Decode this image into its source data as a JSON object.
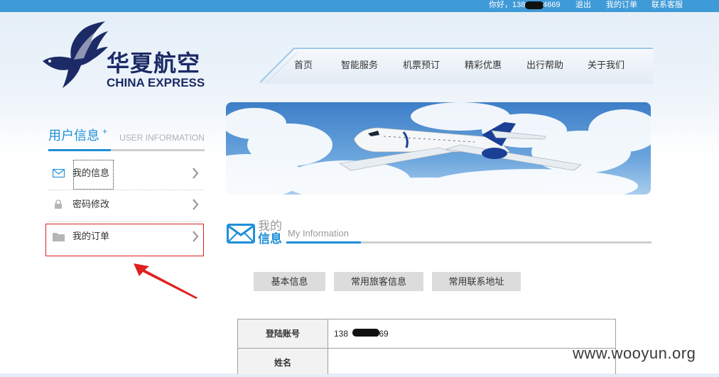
{
  "topbar": {
    "greeting": "你好，138",
    "phone_tail": "4669",
    "logout": "退出",
    "my_orders": "我的订单",
    "contact": "联系客服"
  },
  "logo": {
    "cn": "华夏航空",
    "en": "CHINA EXPRESS",
    "icon": "bird-icon"
  },
  "nav": {
    "items": [
      "首页",
      "智能服务",
      "机票预订",
      "精彩优惠",
      "出行帮助",
      "关于我们"
    ]
  },
  "banner": {
    "icon": "airplane-banner"
  },
  "sidebar": {
    "title": "用户信息",
    "plus": "+",
    "subtitle": "USER INFORMATION",
    "items": [
      {
        "label": "我的信息",
        "icon": "envelope-icon"
      },
      {
        "label": "密码修改",
        "icon": "lock-icon"
      },
      {
        "label": "我的订单",
        "icon": "folder-icon"
      }
    ]
  },
  "info": {
    "title_line1": "我的",
    "title_line2": "信息",
    "title_en": "My Information"
  },
  "tabs": [
    "基本信息",
    "常用旅客信息",
    "常用联系地址"
  ],
  "table": {
    "rows": [
      {
        "label": "登陆账号",
        "value_prefix": "138",
        "value_suffix": "4669"
      },
      {
        "label": "姓名",
        "value": ""
      }
    ]
  },
  "watermark": "www.wooyun.org",
  "colors": {
    "topbar": "#3f9ad8",
    "accent": "#1e8fd8",
    "highlight": "#e02020",
    "brand": "#1c2a66"
  }
}
